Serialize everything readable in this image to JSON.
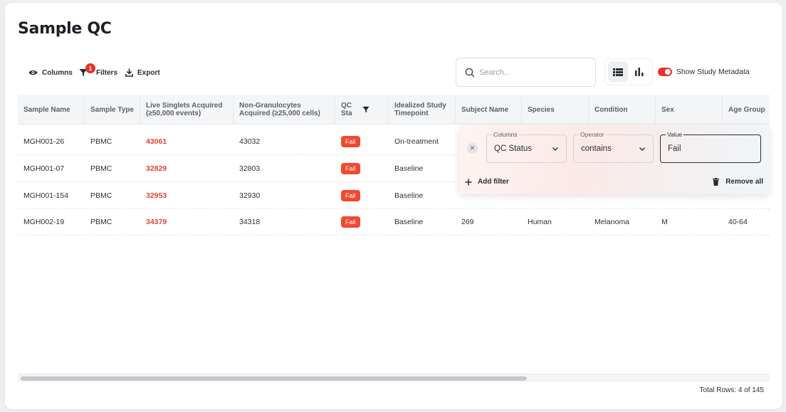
{
  "page": {
    "title": "Sample QC"
  },
  "toolbar": {
    "columns_label": "Columns",
    "filters_label": "Filters",
    "filters_count": "1",
    "export_label": "Export"
  },
  "search": {
    "placeholder": "Search...",
    "value": ""
  },
  "view_toggle": {
    "active": "list"
  },
  "metadata_toggle": {
    "label": "Show Study Metadata",
    "on": true
  },
  "table": {
    "columns": [
      "Sample Name",
      "Sample Type",
      "Live Singlets Acquired (≥50,000 events)",
      "Non-Granulocytes Acquired (≥25,000 cells)",
      "QC Sta",
      "Idealized Study Timepoint",
      "Subject Name",
      "Species",
      "Condition",
      "Sex",
      "Age Group"
    ],
    "rows": [
      {
        "sample_name": "MGH001-26",
        "sample_type": "PBMC",
        "live_singlets": "43061",
        "non_granulocytes": "43032",
        "qc_status": "Fail",
        "timepoint": "On-treatment",
        "subject": "",
        "species": "",
        "condition": "",
        "sex": "",
        "age_group": ""
      },
      {
        "sample_name": "MGH001-07",
        "sample_type": "PBMC",
        "live_singlets": "32829",
        "non_granulocytes": "32803",
        "qc_status": "Fail",
        "timepoint": "Baseline",
        "subject": "",
        "species": "",
        "condition": "",
        "sex": "",
        "age_group": ""
      },
      {
        "sample_name": "MGH001-154",
        "sample_type": "PBMC",
        "live_singlets": "32953",
        "non_granulocytes": "32930",
        "qc_status": "Fail",
        "timepoint": "Baseline",
        "subject": "",
        "species": "",
        "condition": "",
        "sex": "",
        "age_group": ""
      },
      {
        "sample_name": "MGH002-19",
        "sample_type": "PBMC",
        "live_singlets": "34379",
        "non_granulocytes": "34318",
        "qc_status": "Fail",
        "timepoint": "Baseline",
        "subject": "269",
        "species": "Human",
        "condition": "Melanoma",
        "sex": "M",
        "age_group": "40-64"
      }
    ]
  },
  "filter_panel": {
    "columns_label": "Columns",
    "columns_value": "QC Status",
    "operator_label": "Operator",
    "operator_value": "contains",
    "value_label": "Value",
    "value_value": "Fail",
    "add_filter_label": "Add filter",
    "remove_all_label": "Remove all"
  },
  "footer": {
    "total_rows": "Total Rows: 4 of 145"
  },
  "colors": {
    "accent": "#e8322c",
    "fail_badge": "#ef4a2f",
    "highlight_value": "#e0442f"
  }
}
